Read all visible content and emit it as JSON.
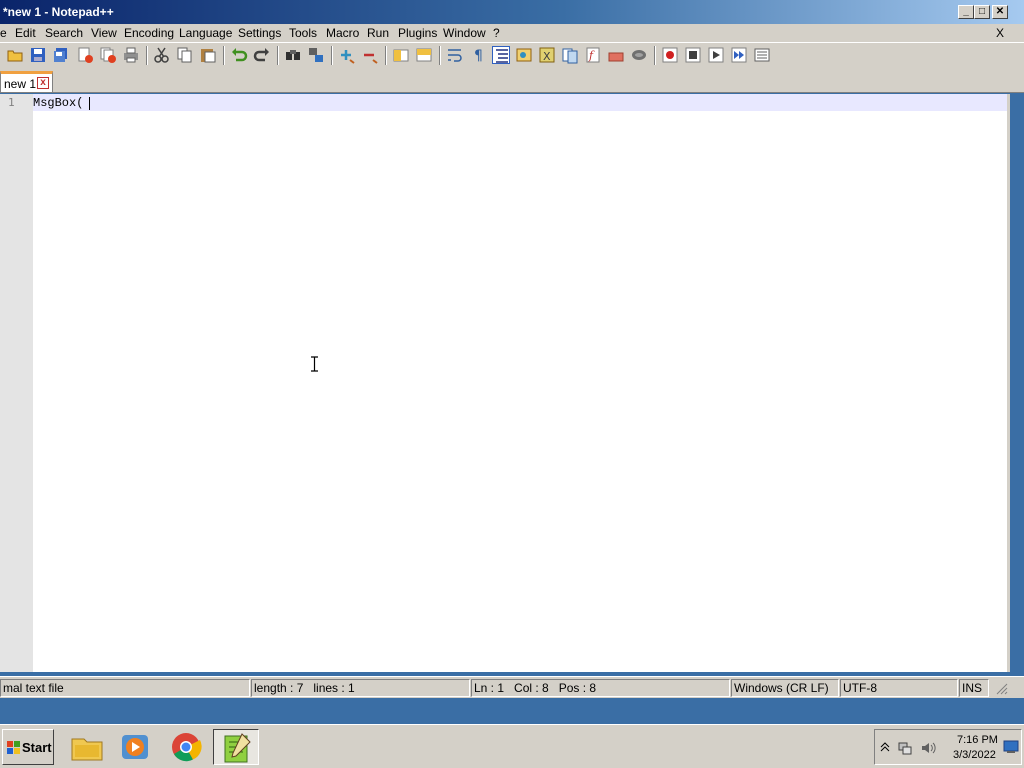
{
  "window": {
    "title": "*new 1 - Notepad++",
    "minimize_glyph": "_",
    "maximize_glyph": "□",
    "close_glyph": "✕",
    "doc_close_glyph": "X"
  },
  "menu": [
    "e",
    "Edit",
    "Search",
    "View",
    "Encoding",
    "Language",
    "Settings",
    "Tools",
    "Macro",
    "Run",
    "Plugins",
    "Window",
    "?"
  ],
  "toolbar_icons": [
    "open-icon",
    "save-icon",
    "save-all-icon",
    "close-icon",
    "close-all-icon",
    "print-icon",
    "cut-icon",
    "copy-icon",
    "paste-icon",
    "undo-icon",
    "redo-icon",
    "find-icon",
    "replace-icon",
    "zoom-in-icon",
    "zoom-out-icon",
    "sync-v-icon",
    "sync-h-icon",
    "word-wrap-icon",
    "show-all-chars-icon",
    "indent-guide-icon",
    "lang-icon",
    "map-icon",
    "doc-list-icon",
    "function-list-icon",
    "folder-workspace-icon",
    "monitor-icon",
    "record-macro-icon",
    "stop-macro-icon",
    "play-macro-icon",
    "run-macro-multiple-icon",
    "save-macro-icon"
  ],
  "tab": {
    "label": "new 1",
    "close_glyph": "x"
  },
  "editor": {
    "line_number": "1",
    "code": "MsgBox("
  },
  "status": {
    "file_type": "mal text file",
    "length": "length : 7",
    "lines": "lines : 1",
    "ln": "Ln : 1",
    "col": "Col : 8",
    "pos": "Pos : 8",
    "eol": "Windows (CR LF)",
    "encoding": "UTF-8",
    "mode": "INS"
  },
  "taskbar": {
    "start_label": "Start",
    "apps": [
      "file-explorer-icon",
      "media-player-icon",
      "chrome-icon",
      "notepadpp-icon"
    ],
    "clock_time": "7:16 PM",
    "clock_date": "3/3/2022"
  },
  "colors": {
    "titlebar_start": "#0a246a",
    "chrome": "#d4d0c8",
    "current_line": "#e8e8ff",
    "tab_accent": "#f0a040"
  }
}
